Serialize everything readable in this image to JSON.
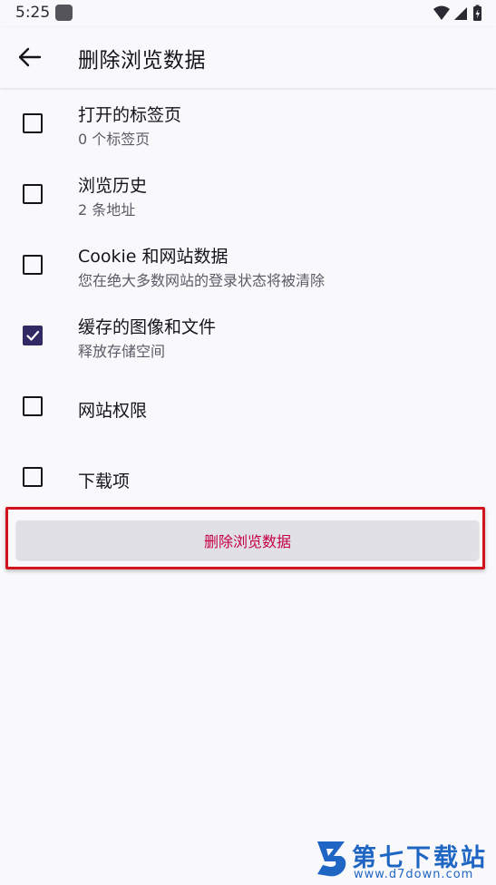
{
  "status_bar": {
    "time": "5:25"
  },
  "app_bar": {
    "title": "删除浏览数据"
  },
  "options": [
    {
      "title": "打开的标签页",
      "subtitle": "0 个标签页",
      "checked": false
    },
    {
      "title": "浏览历史",
      "subtitle": "2 条地址",
      "checked": false
    },
    {
      "title": "Cookie 和网站数据",
      "subtitle": "您在绝大多数网站的登录状态将被清除",
      "checked": false
    },
    {
      "title": "缓存的图像和文件",
      "subtitle": "释放存储空间",
      "checked": true
    },
    {
      "title": "网站权限",
      "subtitle": "",
      "checked": false
    },
    {
      "title": "下载项",
      "subtitle": "",
      "checked": false
    }
  ],
  "delete_button": {
    "label": "删除浏览数据"
  },
  "watermark": {
    "name": "第七下载站",
    "url": "www.d7down.com"
  },
  "colors": {
    "accent": "#312a65",
    "destructive": "#c50042",
    "highlight": "#d2131b",
    "watermark": "#1f66c4"
  }
}
